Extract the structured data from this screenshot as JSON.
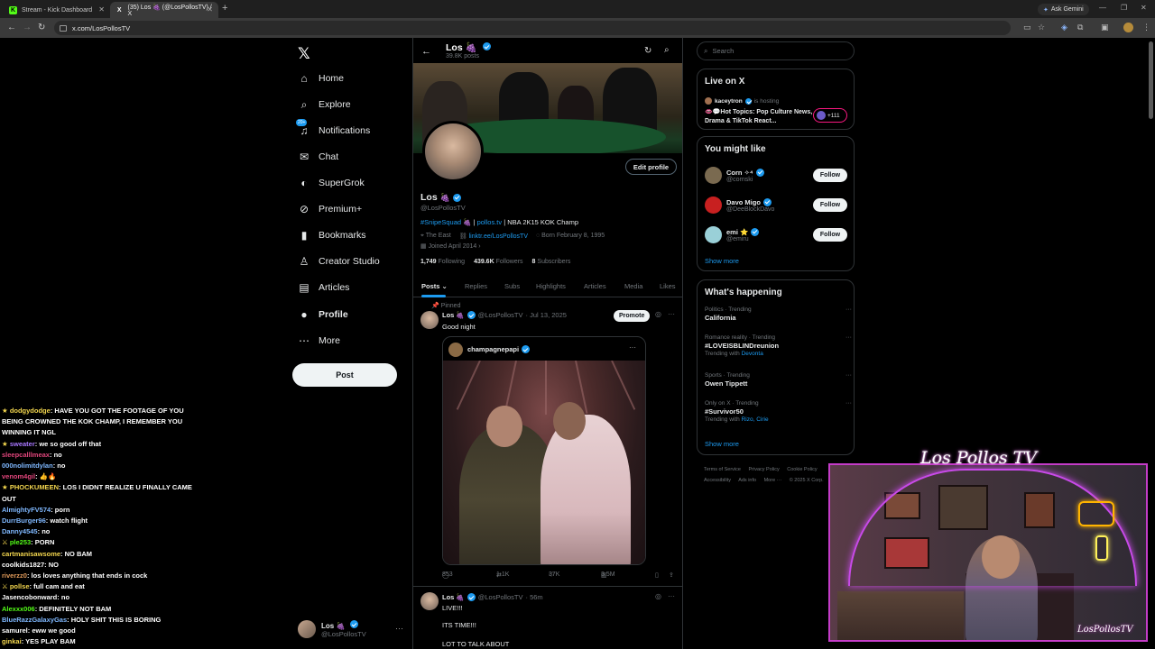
{
  "browser": {
    "tabs": [
      {
        "label": "Stream - Kick Dashboard",
        "icon": "kick-icon"
      },
      {
        "label": "(35) Los 🍇 (@LosPollosTV) / X",
        "icon": "x-icon"
      }
    ],
    "new_tab": "+",
    "ask_gemini": "Ask Gemini",
    "url": "x.com/LosPollosTV"
  },
  "sidebar": {
    "logo": "𝕏",
    "items": [
      {
        "label": "Home",
        "icon": "⌂"
      },
      {
        "label": "Explore",
        "icon": "⌕"
      },
      {
        "label": "Notifications",
        "icon": "♫",
        "badge": "20+"
      },
      {
        "label": "Chat",
        "icon": "✉"
      },
      {
        "label": "SuperGrok",
        "icon": "◐"
      },
      {
        "label": "Premium+",
        "icon": "⊘"
      },
      {
        "label": "Bookmarks",
        "icon": "▮"
      },
      {
        "label": "Creator Studio",
        "icon": "♙"
      },
      {
        "label": "Articles",
        "icon": "▤"
      },
      {
        "label": "Profile",
        "icon": "●"
      },
      {
        "label": "More",
        "icon": "⋯"
      }
    ],
    "post_button": "Post",
    "account": {
      "name": "Los 🍇",
      "handle": "@LosPollosTV",
      "more": "···"
    }
  },
  "chat": [
    {
      "user": "dodgydodge",
      "color": "#f3d64e",
      "text": "HAVE YOU GOT THE FOOTAGE OF YOU BEING CROWNED THE KOK CHAMP, I REMEMBER YOU WINNING IT NGL",
      "prefix": "★ "
    },
    {
      "user": "sweater",
      "color": "#a877ff",
      "text": "we so good off that",
      "prefix": "★ "
    },
    {
      "user": "sleepcalllmeax",
      "color": "#e0457b",
      "text": "no",
      "prefix": ""
    },
    {
      "user": "000nolimitdylan",
      "color": "#7fb8ff",
      "text": "no",
      "prefix": ""
    },
    {
      "user": "venom4gil",
      "color": "#e0457b",
      "text": "👍🔥",
      "prefix": ""
    },
    {
      "user": "PHOCKUMEEN",
      "color": "#f3d64e",
      "text": "LOS I DIDNT REALIZE U FINALLY CAME OUT",
      "prefix": "★ "
    },
    {
      "user": "AlmightyFV574",
      "color": "#7fb8ff",
      "text": "porn",
      "prefix": ""
    },
    {
      "user": "DurrBurger96",
      "color": "#7fb8ff",
      "text": "watch flight",
      "prefix": ""
    },
    {
      "user": "Danny4545",
      "color": "#7fb8ff",
      "text": "no",
      "prefix": ""
    },
    {
      "user": "ple253",
      "color": "#53fc18",
      "text": "PORN",
      "prefix": "⚔ "
    },
    {
      "user": "cartmanisawsome",
      "color": "#f3d64e",
      "text": "NO BAM",
      "prefix": ""
    },
    {
      "user": "coolkids1827",
      "color": "#ffffff",
      "text": "NO",
      "prefix": ""
    },
    {
      "user": "riverzz0",
      "color": "#e09a5a",
      "text": "los loves anything that ends in cock",
      "prefix": ""
    },
    {
      "user": "pollse",
      "color": "#f3d64e",
      "text": "full cam and eat",
      "prefix": "⚔ "
    },
    {
      "user": "Jasencobonward",
      "color": "#ffffff",
      "text": "no",
      "prefix": ""
    },
    {
      "user": "Alexxx006",
      "color": "#53fc18",
      "text": "DEFINITELY NOT BAM",
      "prefix": ""
    },
    {
      "user": "BlueRazzGalaxyGas",
      "color": "#7fb8ff",
      "text": "HOLY SHIT THIS IS BORING",
      "prefix": ""
    },
    {
      "user": "samurel",
      "color": "#ffffff",
      "text": "eww we good",
      "prefix": ""
    },
    {
      "user": "ginkai",
      "color": "#f3d64e",
      "text": "YES PLAY BAM",
      "prefix": ""
    }
  ],
  "profile": {
    "header_name": "Los 🍇",
    "post_count": "39.8K posts",
    "name": "Los",
    "handle": "@LosPollosTV",
    "edit_button": "Edit profile",
    "bio_link1": "#SnipeSquad 🍇",
    "bio_sep": " | ",
    "bio_link2": "pollos.tv",
    "bio_rest": " | NBA 2K15 KOK Champ",
    "location": "The East",
    "website": "linktr.ee/LosPollosTV",
    "born": "Born February 8, 1995",
    "joined": "Joined April 2014",
    "following_count": "1,749",
    "following_label": "Following",
    "followers_count": "439.6K",
    "followers_label": "Followers",
    "subscribers_count": "8",
    "subscribers_label": "Subscribers",
    "tabs": [
      "Posts",
      "Replies",
      "Subs",
      "Highlights",
      "Articles",
      "Media",
      "Likes"
    ]
  },
  "tweet1": {
    "pinned": "Pinned",
    "name": "Los 🍇",
    "handle": "@LosPollosTV",
    "date": "· Jul 13, 2025",
    "promote": "Promote",
    "text": "Good night",
    "quote_author": "champagnepapi",
    "replies": "853",
    "reposts": "1.1K",
    "likes": "37K",
    "views": "3.5M"
  },
  "tweet2": {
    "name": "Los 🍇",
    "handle": "@LosPollosTV",
    "time": "· 56m",
    "line1": "LIVE!!!",
    "line2": "ITS TIME!!!",
    "line3": "LOT TO TALK ABOUT"
  },
  "right": {
    "search_placeholder": "Search",
    "live": {
      "title": "Live on X",
      "host": "kaceytron",
      "hosting": "is hosting",
      "space_title": "👄💬Hot Topics: Pop Culture News, Drama & TikTok React...",
      "listeners": "+111"
    },
    "wtf": {
      "title": "You might like",
      "users": [
        {
          "name": "Corn ✧⁴",
          "handle": "@cornski",
          "color": "#7a6a50"
        },
        {
          "name": "Davo Migo",
          "handle": "@DeeBlockDavo",
          "color": "#c82020"
        },
        {
          "name": "emi ⭐",
          "handle": "@emiru",
          "color": "#9ad0d8"
        }
      ],
      "follow": "Follow",
      "show_more": "Show more"
    },
    "trends": {
      "title": "What's happening",
      "items": [
        {
          "context": "Politics · Trending",
          "topic": "California",
          "with": ""
        },
        {
          "context": "Romance reality · Trending",
          "topic": "#LOVEISBLINDreunion",
          "with_prefix": "Trending with ",
          "with": "Devonta"
        },
        {
          "context": "Sports · Trending",
          "topic": "Owen Tippett",
          "with": ""
        },
        {
          "context": "Only on X · Trending",
          "topic": "#Survivor50",
          "with_prefix": "Trending with ",
          "with": "Rizo, Cirie"
        }
      ],
      "show_more": "Show more"
    },
    "footer": [
      "Terms of Service",
      "Privacy Policy",
      "Cookie Policy",
      "Accessibility",
      "Ads info",
      "More ···",
      "© 2025 X Corp."
    ]
  },
  "overlay": {
    "signature_top": "Los Pollos TV",
    "signature_bottom": "LosPollosTV"
  }
}
